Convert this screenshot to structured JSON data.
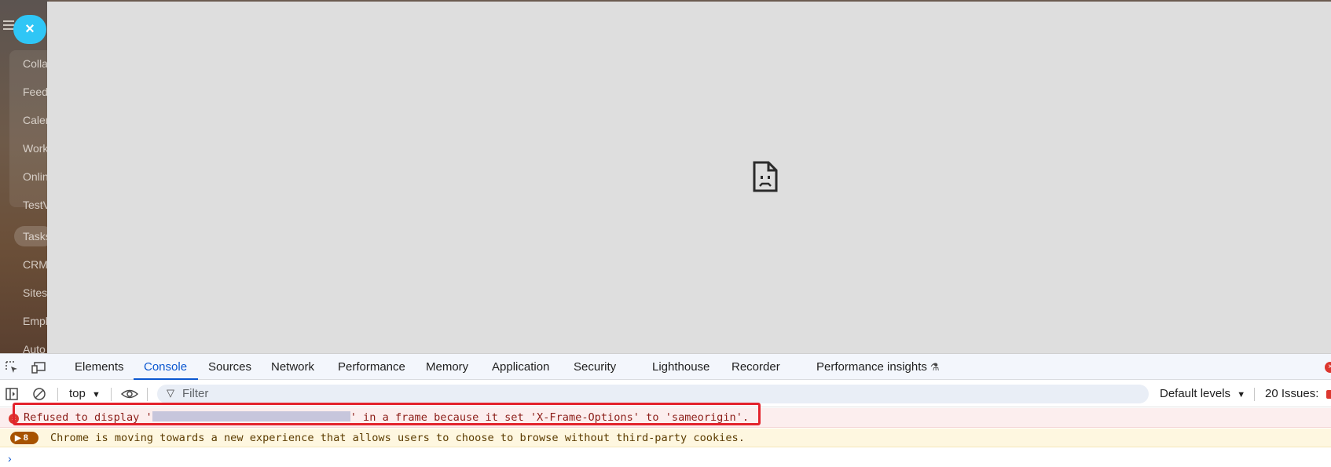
{
  "sidebar": {
    "close_symbol": "×",
    "items": [
      "Colla",
      "Feed",
      "Calen",
      "Work",
      "Onlin",
      "TestV",
      "Tasks",
      "CRM",
      "Sites",
      "Empl",
      "Auto"
    ]
  },
  "devtools": {
    "tabs": [
      "Elements",
      "Console",
      "Sources",
      "Network",
      "Performance",
      "Memory",
      "Application",
      "Security",
      "Lighthouse",
      "Recorder",
      "Performance insights"
    ],
    "active_tab": "Console",
    "toolbar": {
      "context": "top",
      "filter_placeholder": "Filter",
      "levels": "Default levels",
      "issues": "20 Issues:"
    },
    "console": {
      "error_prefix": "Refused to display '",
      "error_suffix": "' in a frame because it set 'X-Frame-Options' to 'sameorigin'.",
      "warning_count": "8",
      "warning_text": "Chrome is moving towards a new experience that allows users to choose to browse without third-party cookies."
    }
  },
  "colors": {
    "accent": "#0b57d0",
    "error": "#dc362e",
    "highlight": "#e3232c",
    "close_button": "#2fc6f6"
  }
}
